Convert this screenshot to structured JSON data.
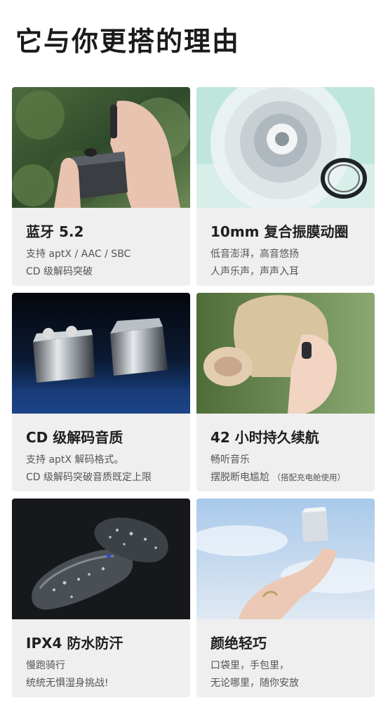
{
  "page_title": "它与你更搭的理由",
  "cards": [
    {
      "heading": "蓝牙 5.2",
      "line1": "支持 aptX / AAC / SBC",
      "line2": "CD 级解码突破",
      "image": "earbuds-case-in-hand-forest-photo"
    },
    {
      "heading": "10mm 复合振膜动圈",
      "line1": "低音澎湃，高音悠扬",
      "line2": "人声乐声，声声入耳",
      "image": "driver-unit-exploded-photo"
    },
    {
      "heading": "CD 级解码音质",
      "line1": "支持 aptX 解码格式。",
      "line2": "CD 级解码突破音质既定上限",
      "image": "two-chrome-cases-photo"
    },
    {
      "heading": "42 小时持久续航",
      "line1": "畅听音乐",
      "line2": "摆脱断电尴尬",
      "note": "（搭配充电舱使用）",
      "image": "woman-wearing-earbud-photo"
    },
    {
      "heading": "IPX4 防水防汗",
      "line1": "慢跑骑行",
      "line2": "统统无惧湿身挑战!",
      "image": "wet-earbuds-photo"
    },
    {
      "heading": "颜绝轻巧",
      "line1": "口袋里，手包里，",
      "line2": "无论哪里，随你安放",
      "image": "hand-holding-case-sky-photo"
    }
  ]
}
